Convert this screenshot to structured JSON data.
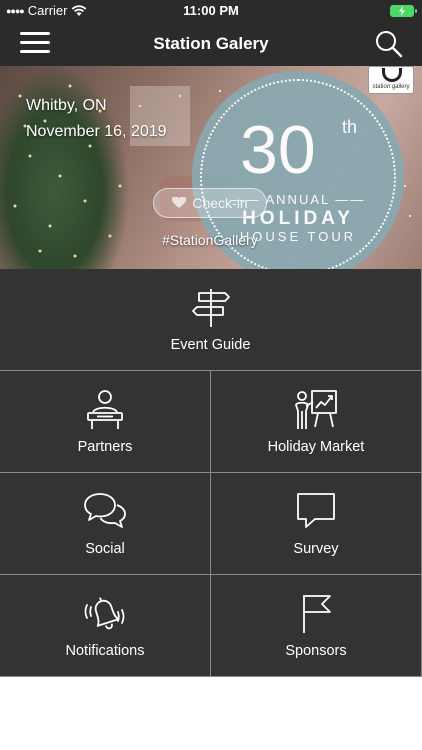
{
  "status_bar": {
    "carrier": "Carrier",
    "time": "11:00 PM"
  },
  "nav": {
    "title": "Station Galery",
    "menu_icon": "hamburger-menu-icon",
    "search_icon": "search-icon"
  },
  "hero": {
    "city": "Whitby, ON",
    "date": "November 16, 2019",
    "checkin_label": "Check-in",
    "hashtag": "#StationGallery",
    "badge": {
      "number": "30",
      "suffix": "th",
      "line1": "ANNUAL",
      "line2": "HOLIDAY",
      "line3": "HOUSE TOUR"
    },
    "logo_text": "station gallery"
  },
  "tiles": [
    {
      "label": "Event Guide",
      "icon": "signpost-icon"
    },
    {
      "label": "Partners",
      "icon": "desk-person-icon"
    },
    {
      "label": "Holiday Market",
      "icon": "presentation-icon"
    },
    {
      "label": "Social",
      "icon": "chat-bubbles-icon"
    },
    {
      "label": "Survey",
      "icon": "speech-bubble-icon"
    },
    {
      "label": "Notifications",
      "icon": "bell-icon"
    },
    {
      "label": "Sponsors",
      "icon": "flag-icon"
    }
  ],
  "colors": {
    "bar_background": "#2b2b2b",
    "tile_background": "#333333",
    "divider": "#8a8a8a",
    "badge": "#8aa8b0",
    "battery": "#4cd964"
  }
}
